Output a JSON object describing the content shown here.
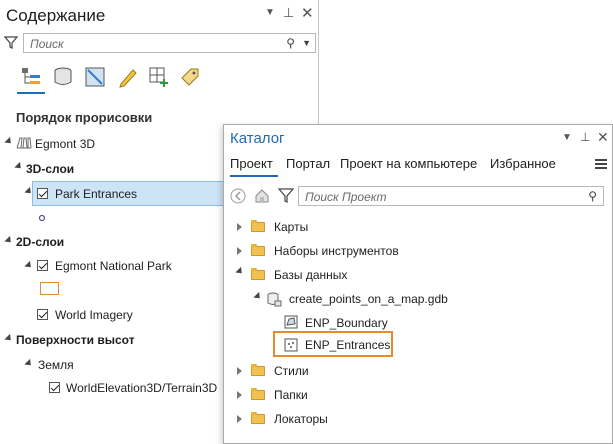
{
  "toc": {
    "title": "Содержание",
    "search_placeholder": "Поиск",
    "section_title": "Порядок прорисовки",
    "map_name": "Egmont 3D",
    "group_3d": "3D-слои",
    "layer_park_entrances": "Park Entrances",
    "group_2d": "2D-слои",
    "layer_egmont_np": "Egmont National Park",
    "layer_world_imagery": "World Imagery",
    "group_surfaces": "Поверхности высот",
    "surface_ground": "Земля",
    "layer_elevation": "WorldElevation3D/Terrain3D"
  },
  "catalog": {
    "title": "Каталог",
    "tabs": [
      "Проект",
      "Портал",
      "Проект на компьютере",
      "Избранное"
    ],
    "active_tab": "Проект",
    "search_placeholder": "Поиск Проект",
    "items": {
      "maps": "Карты",
      "toolboxes": "Наборы инструментов",
      "databases": "Базы данных",
      "gdb": "create_points_on_a_map.gdb",
      "boundary": "ENP_Boundary",
      "entrances": "ENP_Entrances",
      "styles": "Стили",
      "folders": "Папки",
      "locators": "Локаторы"
    }
  },
  "colors": {
    "accent": "#1e6bb8",
    "selection_bg": "#cde4f7",
    "highlight_border": "#e8892b",
    "polygon_outline": "#e8892b"
  }
}
